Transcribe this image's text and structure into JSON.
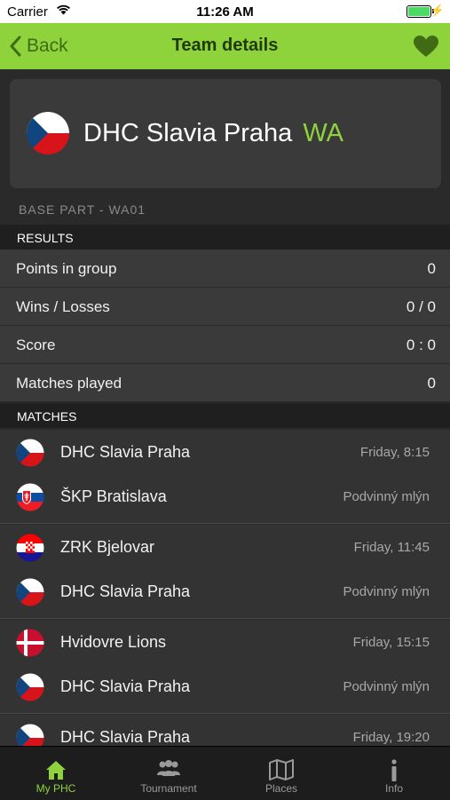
{
  "status_bar": {
    "carrier": "Carrier",
    "time": "11:26 AM"
  },
  "nav": {
    "back_label": "Back",
    "title": "Team details"
  },
  "team": {
    "name": "DHC Slavia Praha",
    "group": "WA"
  },
  "part_label": "BASE PART - WA01",
  "results": {
    "header": "RESULTS",
    "rows": [
      {
        "label": "Points in group",
        "value": "0"
      },
      {
        "label": "Wins / Losses",
        "value": "0 / 0"
      },
      {
        "label": "Score",
        "value": "0 : 0"
      },
      {
        "label": "Matches played",
        "value": "0"
      }
    ]
  },
  "matches": {
    "header": "MATCHES",
    "items": [
      {
        "home": "DHC Slavia Praha",
        "home_flag": "flag-czech",
        "away": "ŠKP Bratislava",
        "away_flag": "flag-slovakia",
        "time": "Friday, 8:15",
        "place": "Podvinný mlýn"
      },
      {
        "home": "ZRK Bjelovar",
        "home_flag": "flag-croatia",
        "away": "DHC Slavia Praha",
        "away_flag": "flag-czech",
        "time": "Friday, 11:45",
        "place": "Podvinný mlýn"
      },
      {
        "home": "Hvidovre Lions",
        "home_flag": "flag-denmark",
        "away": "DHC Slavia Praha",
        "away_flag": "flag-czech",
        "time": "Friday, 15:15",
        "place": "Podvinný mlýn"
      },
      {
        "home": "DHC Slavia Praha",
        "home_flag": "flag-czech",
        "time": "Friday, 19:20"
      }
    ]
  },
  "tabs": [
    {
      "label": "My PHC",
      "icon": "home-icon",
      "active": true
    },
    {
      "label": "Tournament",
      "icon": "people-icon",
      "active": false
    },
    {
      "label": "Places",
      "icon": "map-icon",
      "active": false
    },
    {
      "label": "Info",
      "icon": "info-icon",
      "active": false
    }
  ],
  "colors": {
    "accent": "#8fd33c",
    "background": "#2a2a2a",
    "card": "#3a3a3a"
  }
}
